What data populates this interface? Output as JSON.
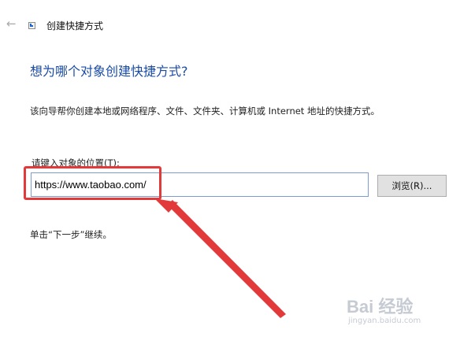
{
  "window": {
    "title": "创建快捷方式",
    "back_icon": "back-arrow-icon"
  },
  "main": {
    "heading": "想为哪个对象创建快捷方式?",
    "description": "该向导帮你创建本地或网络程序、文件、文件夹、计算机或 Internet 地址的快捷方式。",
    "location_label": "请键入对象的位置(T):",
    "location_value": "https://www.taobao.com/",
    "browse_label": "浏览(R)...",
    "hint": "单击“下一步”继续。"
  },
  "annotation": {
    "highlight_color": "#e23a3a"
  },
  "watermark": {
    "logo_text": "Bai 经验",
    "site": "jingyan.baidu.com"
  }
}
